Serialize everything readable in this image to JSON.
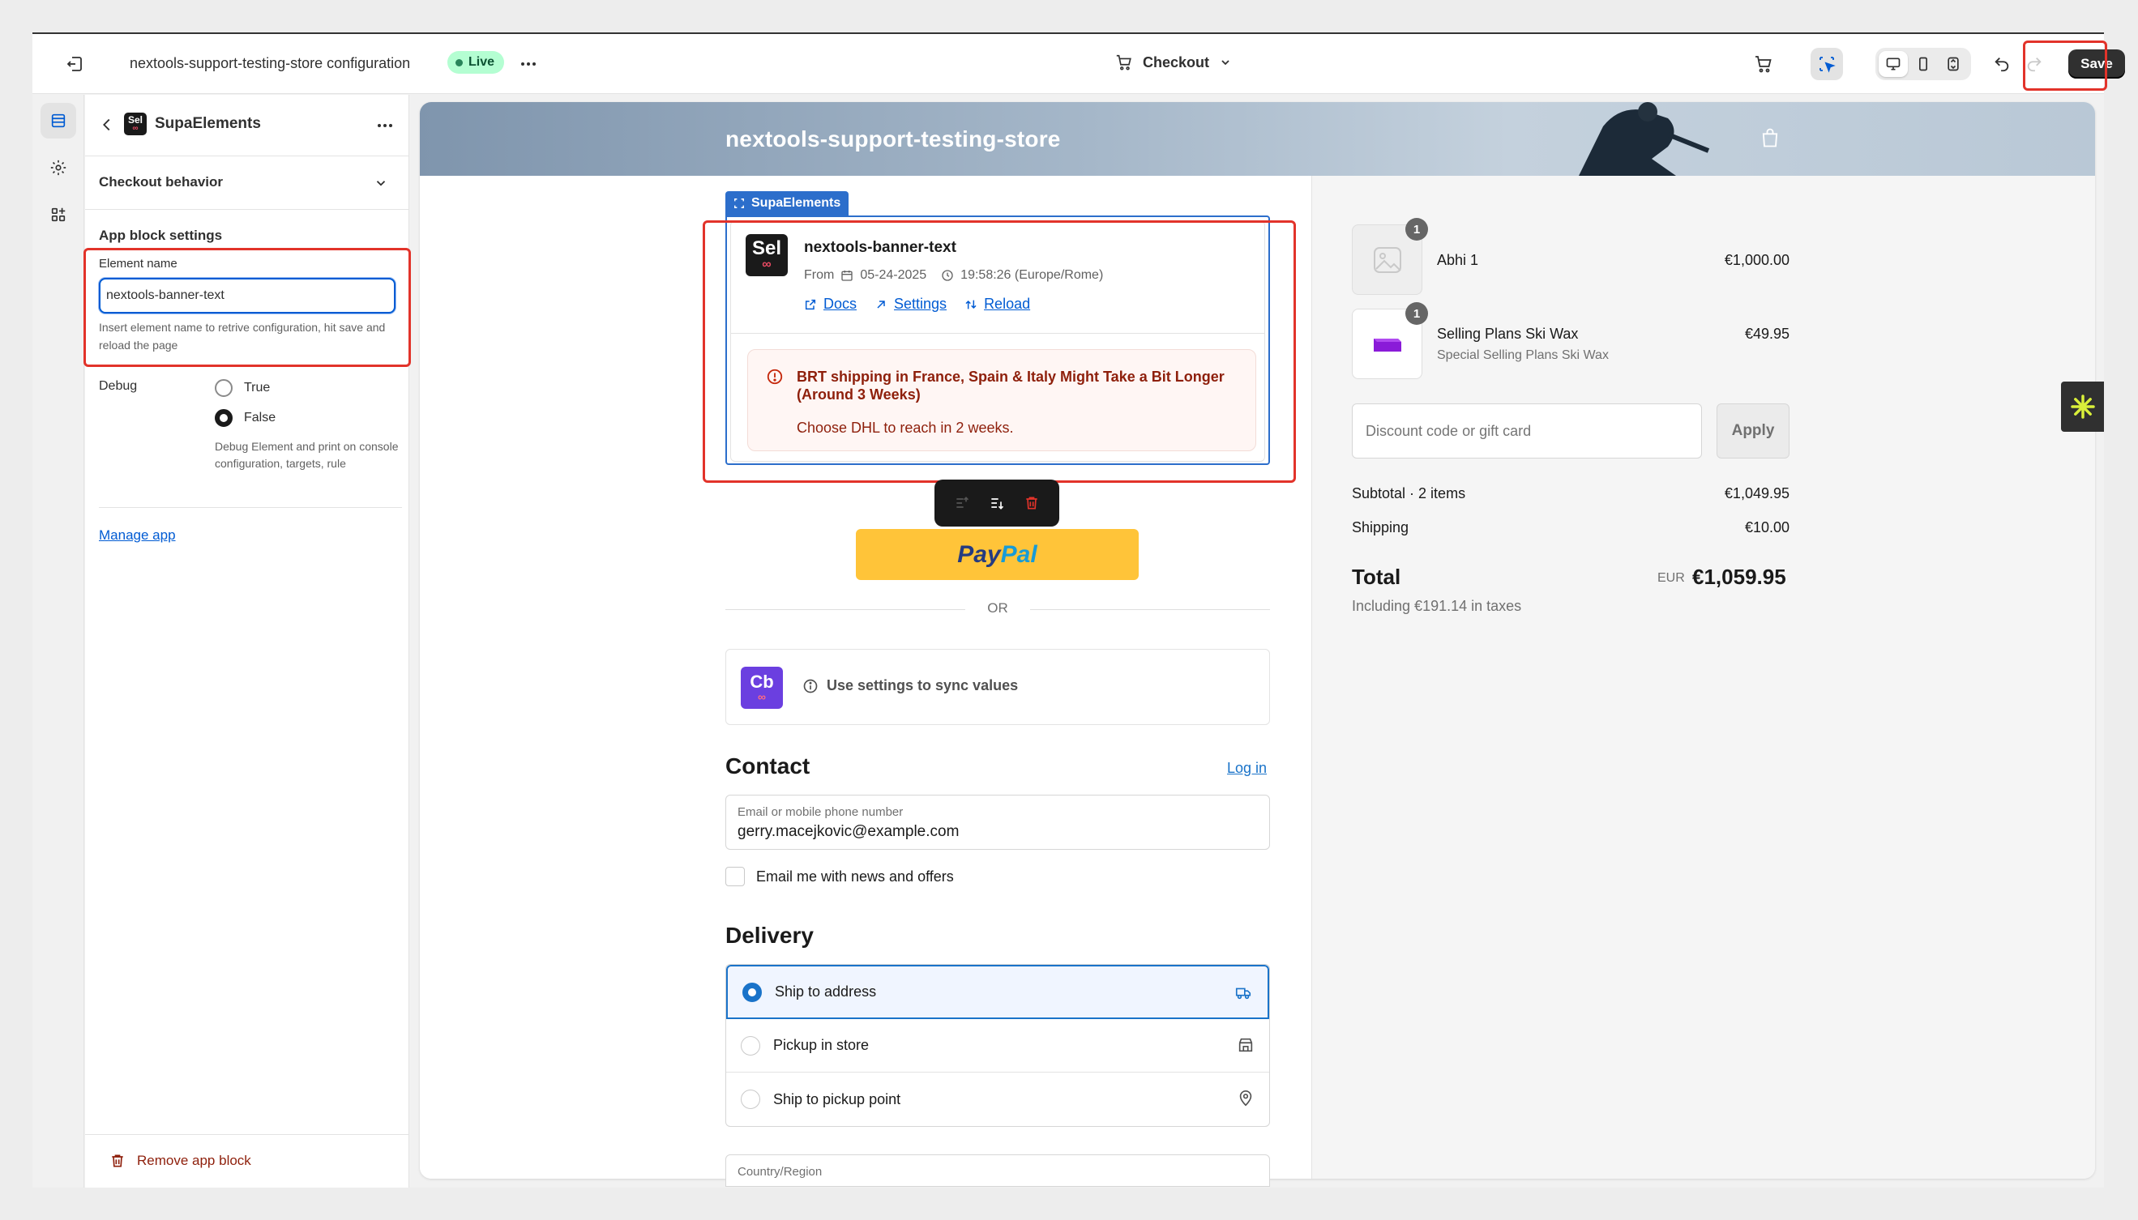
{
  "topbar": {
    "store_title": "nextools-support-testing-store configuration",
    "live_badge": "Live",
    "page_selector": "Checkout",
    "save_label": "Save"
  },
  "panel": {
    "app_logo_text": "Sel",
    "title": "SupaElements",
    "checkout_behavior": "Checkout behavior",
    "settings_heading": "App block settings",
    "element_name_label": "Element name",
    "element_name_value": "nextools-banner-text",
    "element_name_help": "Insert element name to retrive configuration, hit save and reload the page",
    "debug_label": "Debug",
    "debug_options": [
      "True",
      "False"
    ],
    "debug_selected": "False",
    "debug_help": "Debug Element and print on console configuration, targets, rule",
    "manage_app": "Manage app",
    "remove_block": "Remove app block"
  },
  "preview": {
    "store_name": "nextools-support-testing-store",
    "supa_tag": "SupaElements",
    "element": {
      "logo_text": "Sel",
      "title": "nextools-banner-text",
      "from_label": "From",
      "date": "05-24-2025",
      "time": "19:58:26 (Europe/Rome)",
      "links": [
        "Docs",
        "Settings",
        "Reload"
      ]
    },
    "alert": {
      "title": "BRT shipping in France, Spain & Italy Might Take a Bit Longer (Around 3 Weeks)",
      "body": "Choose DHL to reach in 2 weeks."
    },
    "paypal": {
      "part1": "Pay",
      "part2": "Pal"
    },
    "or_text": "OR",
    "cb": {
      "logo_text": "Cb",
      "text": "Use settings to sync values"
    },
    "contact": {
      "heading": "Contact",
      "login": "Log in",
      "email_label": "Email or mobile phone number",
      "email_value": "gerry.macejkovic@example.com",
      "news_label": "Email me with news and offers"
    },
    "delivery": {
      "heading": "Delivery",
      "options": [
        "Ship to address",
        "Pickup in store",
        "Ship to pickup point"
      ],
      "country_label": "Country/Region"
    }
  },
  "summary": {
    "items": [
      {
        "qty": "1",
        "name": "Abhi 1",
        "sub": "",
        "price": "€1,000.00"
      },
      {
        "qty": "1",
        "name": "Selling Plans Ski Wax",
        "sub": "Special Selling Plans Ski Wax",
        "price": "€49.95"
      }
    ],
    "discount_placeholder": "Discount code or gift card",
    "apply_label": "Apply",
    "subtotal_label": "Subtotal · 2 items",
    "subtotal_value": "€1,049.95",
    "shipping_label": "Shipping",
    "shipping_value": "€10.00",
    "total_label": "Total",
    "currency": "EUR",
    "total_value": "€1,059.95",
    "taxes_note": "Including €191.14 in taxes"
  },
  "colors": {
    "accent_blue": "#2c6ecb",
    "save_dark": "#303030",
    "alert_red": "#8e1f0b",
    "highlight_red": "#e2332a",
    "paypal_yellow": "#ffc439"
  }
}
